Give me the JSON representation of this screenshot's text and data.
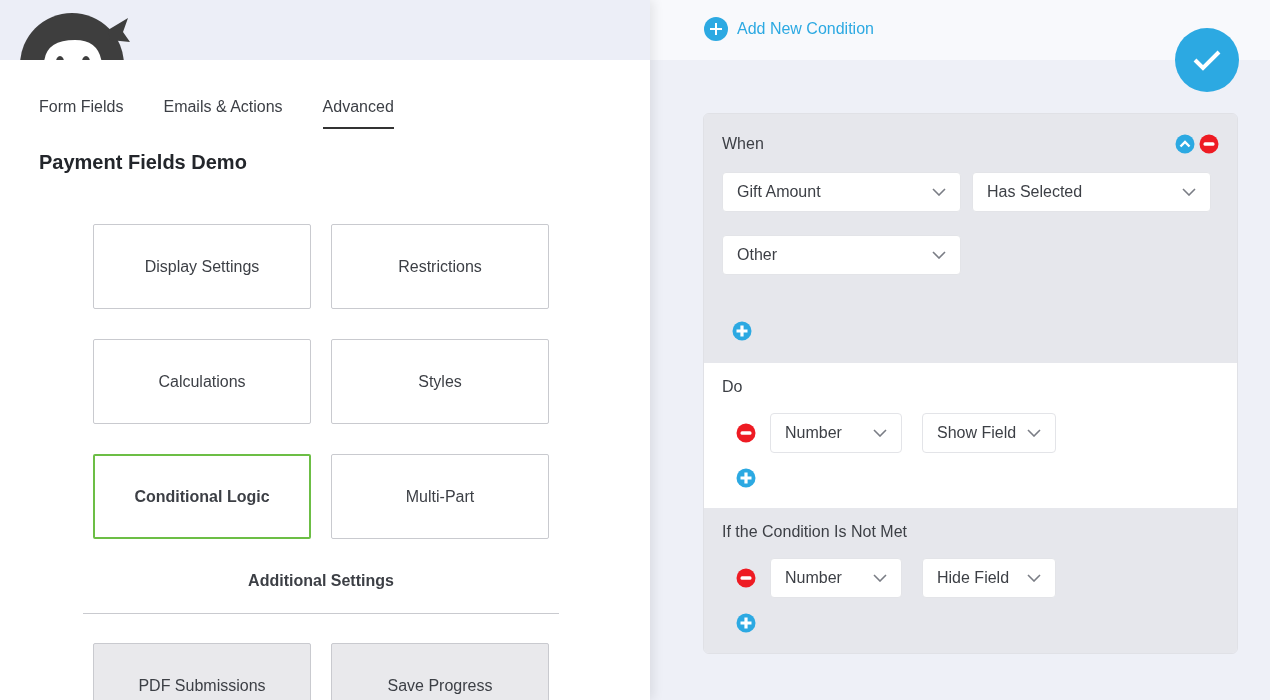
{
  "tabs": [
    {
      "label": "Form Fields",
      "selected": false
    },
    {
      "label": "Emails & Actions",
      "selected": false
    },
    {
      "label": "Advanced",
      "selected": true
    }
  ],
  "form_title": "Payment Fields Demo",
  "settings": [
    {
      "label": "Display Settings",
      "selected": false
    },
    {
      "label": "Restrictions",
      "selected": false
    },
    {
      "label": "Calculations",
      "selected": false
    },
    {
      "label": "Styles",
      "selected": false
    },
    {
      "label": "Conditional Logic",
      "selected": true
    },
    {
      "label": "Multi-Part",
      "selected": false
    }
  ],
  "additional_heading": "Additional Settings",
  "additional": [
    {
      "label": "PDF Submissions"
    },
    {
      "label": "Save Progress"
    }
  ],
  "add_condition": "Add New Condition",
  "condition": {
    "when": {
      "label": "When",
      "selects": [
        "Gift Amount",
        "Has Selected",
        "Other"
      ]
    },
    "do": {
      "label": "Do",
      "actions": [
        {
          "field": "Number",
          "action": "Show Field"
        }
      ]
    },
    "else": {
      "label": "If the Condition Is Not Met",
      "actions": [
        {
          "field": "Number",
          "action": "Hide Field"
        }
      ]
    }
  }
}
